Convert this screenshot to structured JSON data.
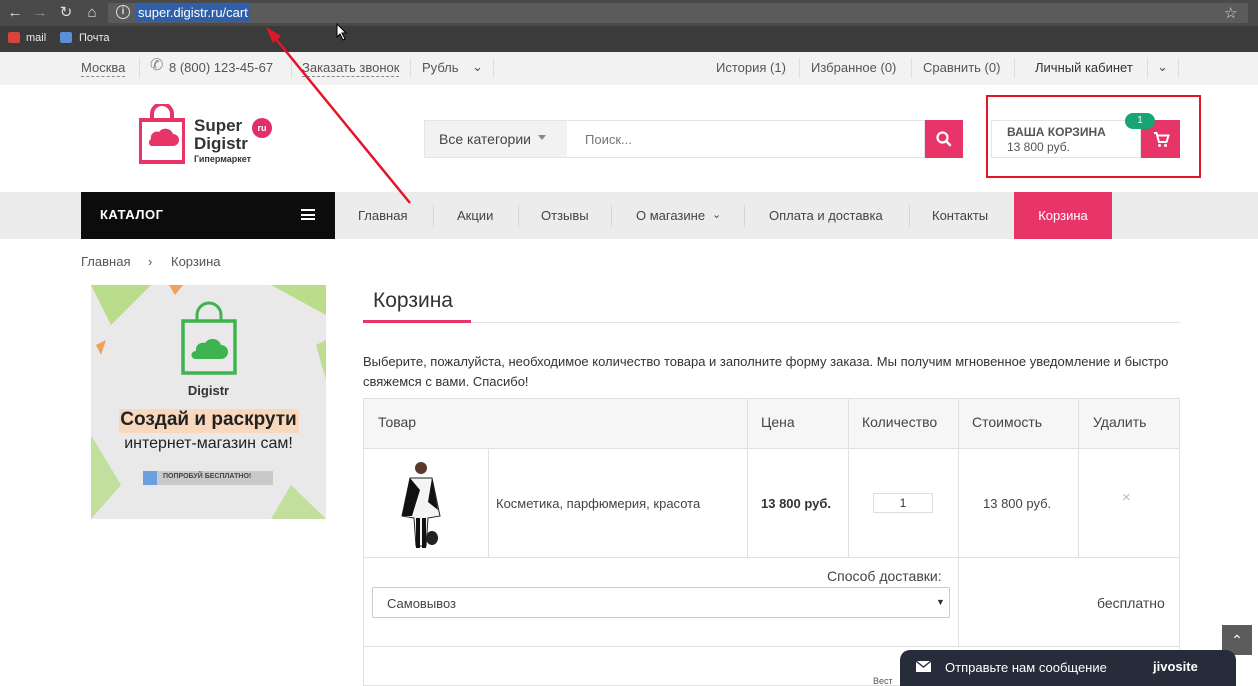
{
  "browser": {
    "url": "super.digistr.ru/cart",
    "bookmarks": [
      "mail",
      "Почта"
    ]
  },
  "topbar": {
    "city": "Москва",
    "phone": "8 (800) 123-45-67",
    "callback": "Заказать звонок",
    "currency": "Рубль",
    "history": "История (1)",
    "favorites": "Избранное (0)",
    "compare": "Сравнить (0)",
    "account": "Личный кабинет"
  },
  "logo": {
    "super": "Super",
    "digistr": "Digistr",
    "ru": "ru",
    "subtitle": "Гипермаркет"
  },
  "search": {
    "category": "Все категории",
    "placeholder": "Поиск..."
  },
  "cart": {
    "title": "ВАША КОРЗИНА",
    "sum": "13 800 руб.",
    "count": "1"
  },
  "nav": {
    "catalog": "КАТАЛОГ",
    "items": [
      "Главная",
      "Акции",
      "Отзывы",
      "О магазине",
      "Оплата и доставка",
      "Контакты"
    ],
    "cart": "Корзина"
  },
  "breadcrumb": [
    "Главная",
    "›",
    "Корзина"
  ],
  "banner": {
    "brand": "Digistr",
    "headline": "Создай и раскрути",
    "subline": "интернет-магазин сам!",
    "button": "ПОПРОБУЙ БЕСПЛАТНО!"
  },
  "page": {
    "title": "Корзина",
    "intro": "Выберите, пожалуйста, необходимое количество товара и заполните форму заказа. Мы получим мгновенное уведомление и быстро свяжемся с вами. Спасибо!"
  },
  "table": {
    "headers": [
      "Товар",
      "Цена",
      "Количество",
      "Стоимость",
      "Удалить"
    ],
    "row": {
      "name": "Косметика, парфюмерия, красота",
      "price": "13 800 руб.",
      "qty": "1",
      "total": "13 800 руб.",
      "delete": "×"
    },
    "delivery_label": "Способ доставки:",
    "delivery_option": "Самовывоз",
    "delivery_price": "бесплатно",
    "weight_label": "Вест"
  },
  "jivo": {
    "text": "Отправьте нам сообщение",
    "brand": "jivosite"
  },
  "colors": {
    "accent": "#e73568",
    "annotation": "#e3152a",
    "badge": "#17a673"
  }
}
